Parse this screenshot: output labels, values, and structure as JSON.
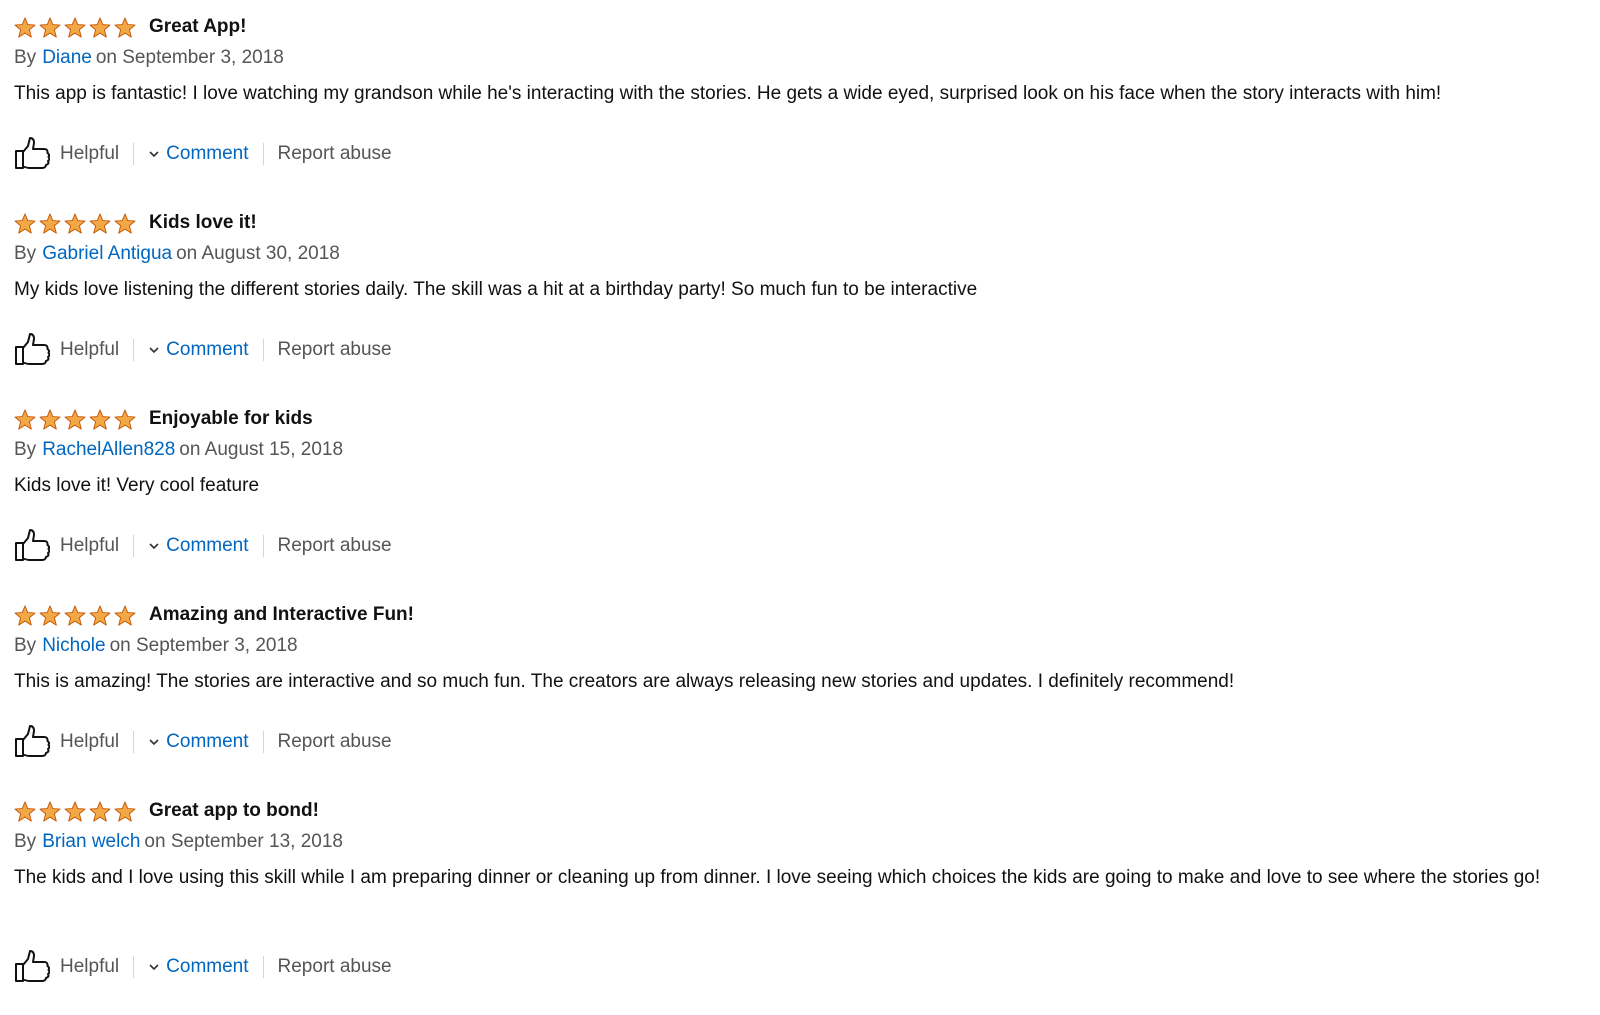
{
  "colors": {
    "star": "#f3a847",
    "star_stroke": "#c45500",
    "link": "#0066c0",
    "muted": "#555555",
    "text": "#111111"
  },
  "labels": {
    "by": "By",
    "helpful": "Helpful",
    "comment": "Comment",
    "report": "Report abuse"
  },
  "icons": {
    "rating": "star-icon",
    "helpful": "thumbs-up-icon",
    "comment": "chevron-down-icon"
  },
  "reviews": [
    {
      "rating": 5,
      "title": "Great App!",
      "author": "Diane",
      "date": "on September 3, 2018",
      "body": "This app is fantastic! I love watching my grandson while he's interacting with the stories. He gets a wide eyed, surprised look on his face when the story interacts with him!"
    },
    {
      "rating": 5,
      "title": "Kids love it!",
      "author": "Gabriel Antigua",
      "date": "on August 30, 2018",
      "body": "My kids love listening the different stories daily. The skill was a hit at a birthday party! So much fun to be interactive"
    },
    {
      "rating": 5,
      "title": "Enjoyable for kids",
      "author": "RachelAllen828",
      "date": "on August 15, 2018",
      "body": "Kids love it! Very cool feature"
    },
    {
      "rating": 5,
      "title": "Amazing and Interactive Fun!",
      "author": "Nichole",
      "date": "on September 3, 2018",
      "body": "This is amazing! The stories are interactive and so much fun. The creators are always releasing new stories and updates. I definitely recommend!"
    },
    {
      "rating": 5,
      "title": "Great app to bond!",
      "author": "Brian welch",
      "date": "on September 13, 2018",
      "body": "The kids and I love using this skill while I am preparing dinner or cleaning up from dinner. I love seeing which choices the kids are going to make and love to see where the stories go!"
    }
  ]
}
